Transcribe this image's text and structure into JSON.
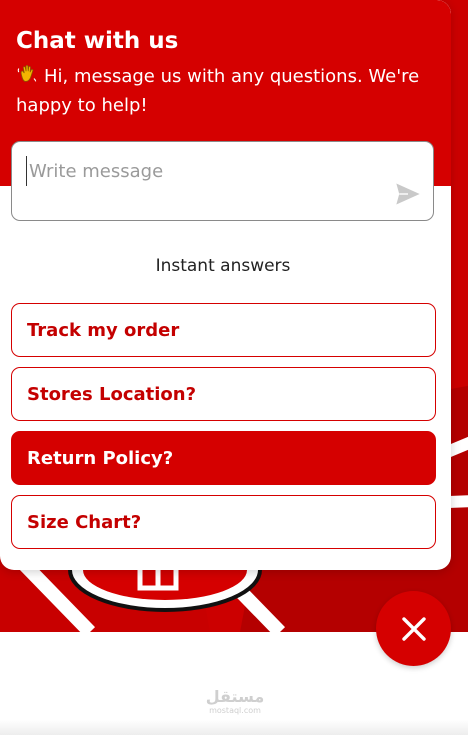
{
  "chat": {
    "title": "Chat with us",
    "greeting_emoji": "wave-emoji",
    "subtitle": "Hi, message us with any questions. We're happy to help!",
    "input_placeholder": "Write message",
    "input_value": "",
    "send_icon": "send-icon",
    "instant_answers_label": "Instant answers",
    "answers": [
      {
        "label": "Track my order",
        "active": false
      },
      {
        "label": "Stores Location?",
        "active": false
      },
      {
        "label": "Return Policy?",
        "active": true
      },
      {
        "label": "Size Chart?",
        "active": false
      }
    ]
  },
  "fab": {
    "icon": "close-icon"
  },
  "watermark": {
    "main": "مستقل",
    "sub": "mostaql.com"
  },
  "colors": {
    "accent": "#d50000",
    "accent_text": "#c40000",
    "panel_bg": "#ffffff"
  }
}
